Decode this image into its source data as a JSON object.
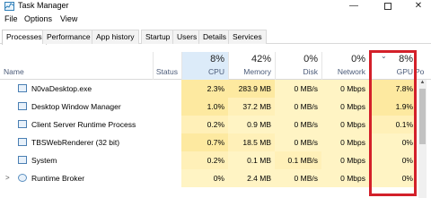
{
  "window": {
    "title": "Task Manager",
    "minimize": "—",
    "close": "✕"
  },
  "menu": [
    "File",
    "Options",
    "View"
  ],
  "tabs": [
    "Processes",
    "Performance",
    "App history",
    "Startup",
    "Users",
    "Details",
    "Services"
  ],
  "active_tab": "Processes",
  "columns": {
    "name": "Name",
    "status": "Status",
    "cpu": {
      "label": "CPU",
      "percent": "8%"
    },
    "memory": {
      "label": "Memory",
      "percent": "42%"
    },
    "disk": {
      "label": "Disk",
      "percent": "0%"
    },
    "network": {
      "label": "Network",
      "percent": "0%"
    },
    "gpu": {
      "label": "GPU",
      "percent": "8%",
      "sorted": true
    },
    "power_partial": "Po"
  },
  "processes": [
    {
      "name": "N0vaDesktop.exe",
      "expandable": false,
      "icon": "app-icon",
      "cpu": "2.3%",
      "memory": "283.9 MB",
      "disk": "0 MB/s",
      "network": "0 Mbps",
      "gpu": "7.8%"
    },
    {
      "name": "Desktop Window Manager",
      "expandable": false,
      "icon": "window-icon",
      "cpu": "1.0%",
      "memory": "37.2 MB",
      "disk": "0 MB/s",
      "network": "0 Mbps",
      "gpu": "1.9%"
    },
    {
      "name": "Client Server Runtime Process",
      "expandable": false,
      "icon": "window-icon",
      "cpu": "0.2%",
      "memory": "0.9 MB",
      "disk": "0 MB/s",
      "network": "0 Mbps",
      "gpu": "0.1%"
    },
    {
      "name": "TBSWebRenderer (32 bit)",
      "expandable": false,
      "icon": "window-icon",
      "cpu": "0.7%",
      "memory": "18.5 MB",
      "disk": "0 MB/s",
      "network": "0 Mbps",
      "gpu": "0%"
    },
    {
      "name": "System",
      "expandable": false,
      "icon": "window-icon",
      "cpu": "0.2%",
      "memory": "0.1 MB",
      "disk": "0.1 MB/s",
      "network": "0 Mbps",
      "gpu": "0%"
    },
    {
      "name": "Runtime Broker",
      "expandable": true,
      "icon": "gear-icon",
      "cpu": "0%",
      "memory": "2.4 MB",
      "disk": "0 MB/s",
      "network": "0 Mbps",
      "gpu": "0%"
    }
  ],
  "colors": {
    "cpu_header_bg": "#dcebf9",
    "cell_light": "#fff4c4",
    "cell_medium": "#fde9a0",
    "highlight_red": "#d3202a"
  }
}
